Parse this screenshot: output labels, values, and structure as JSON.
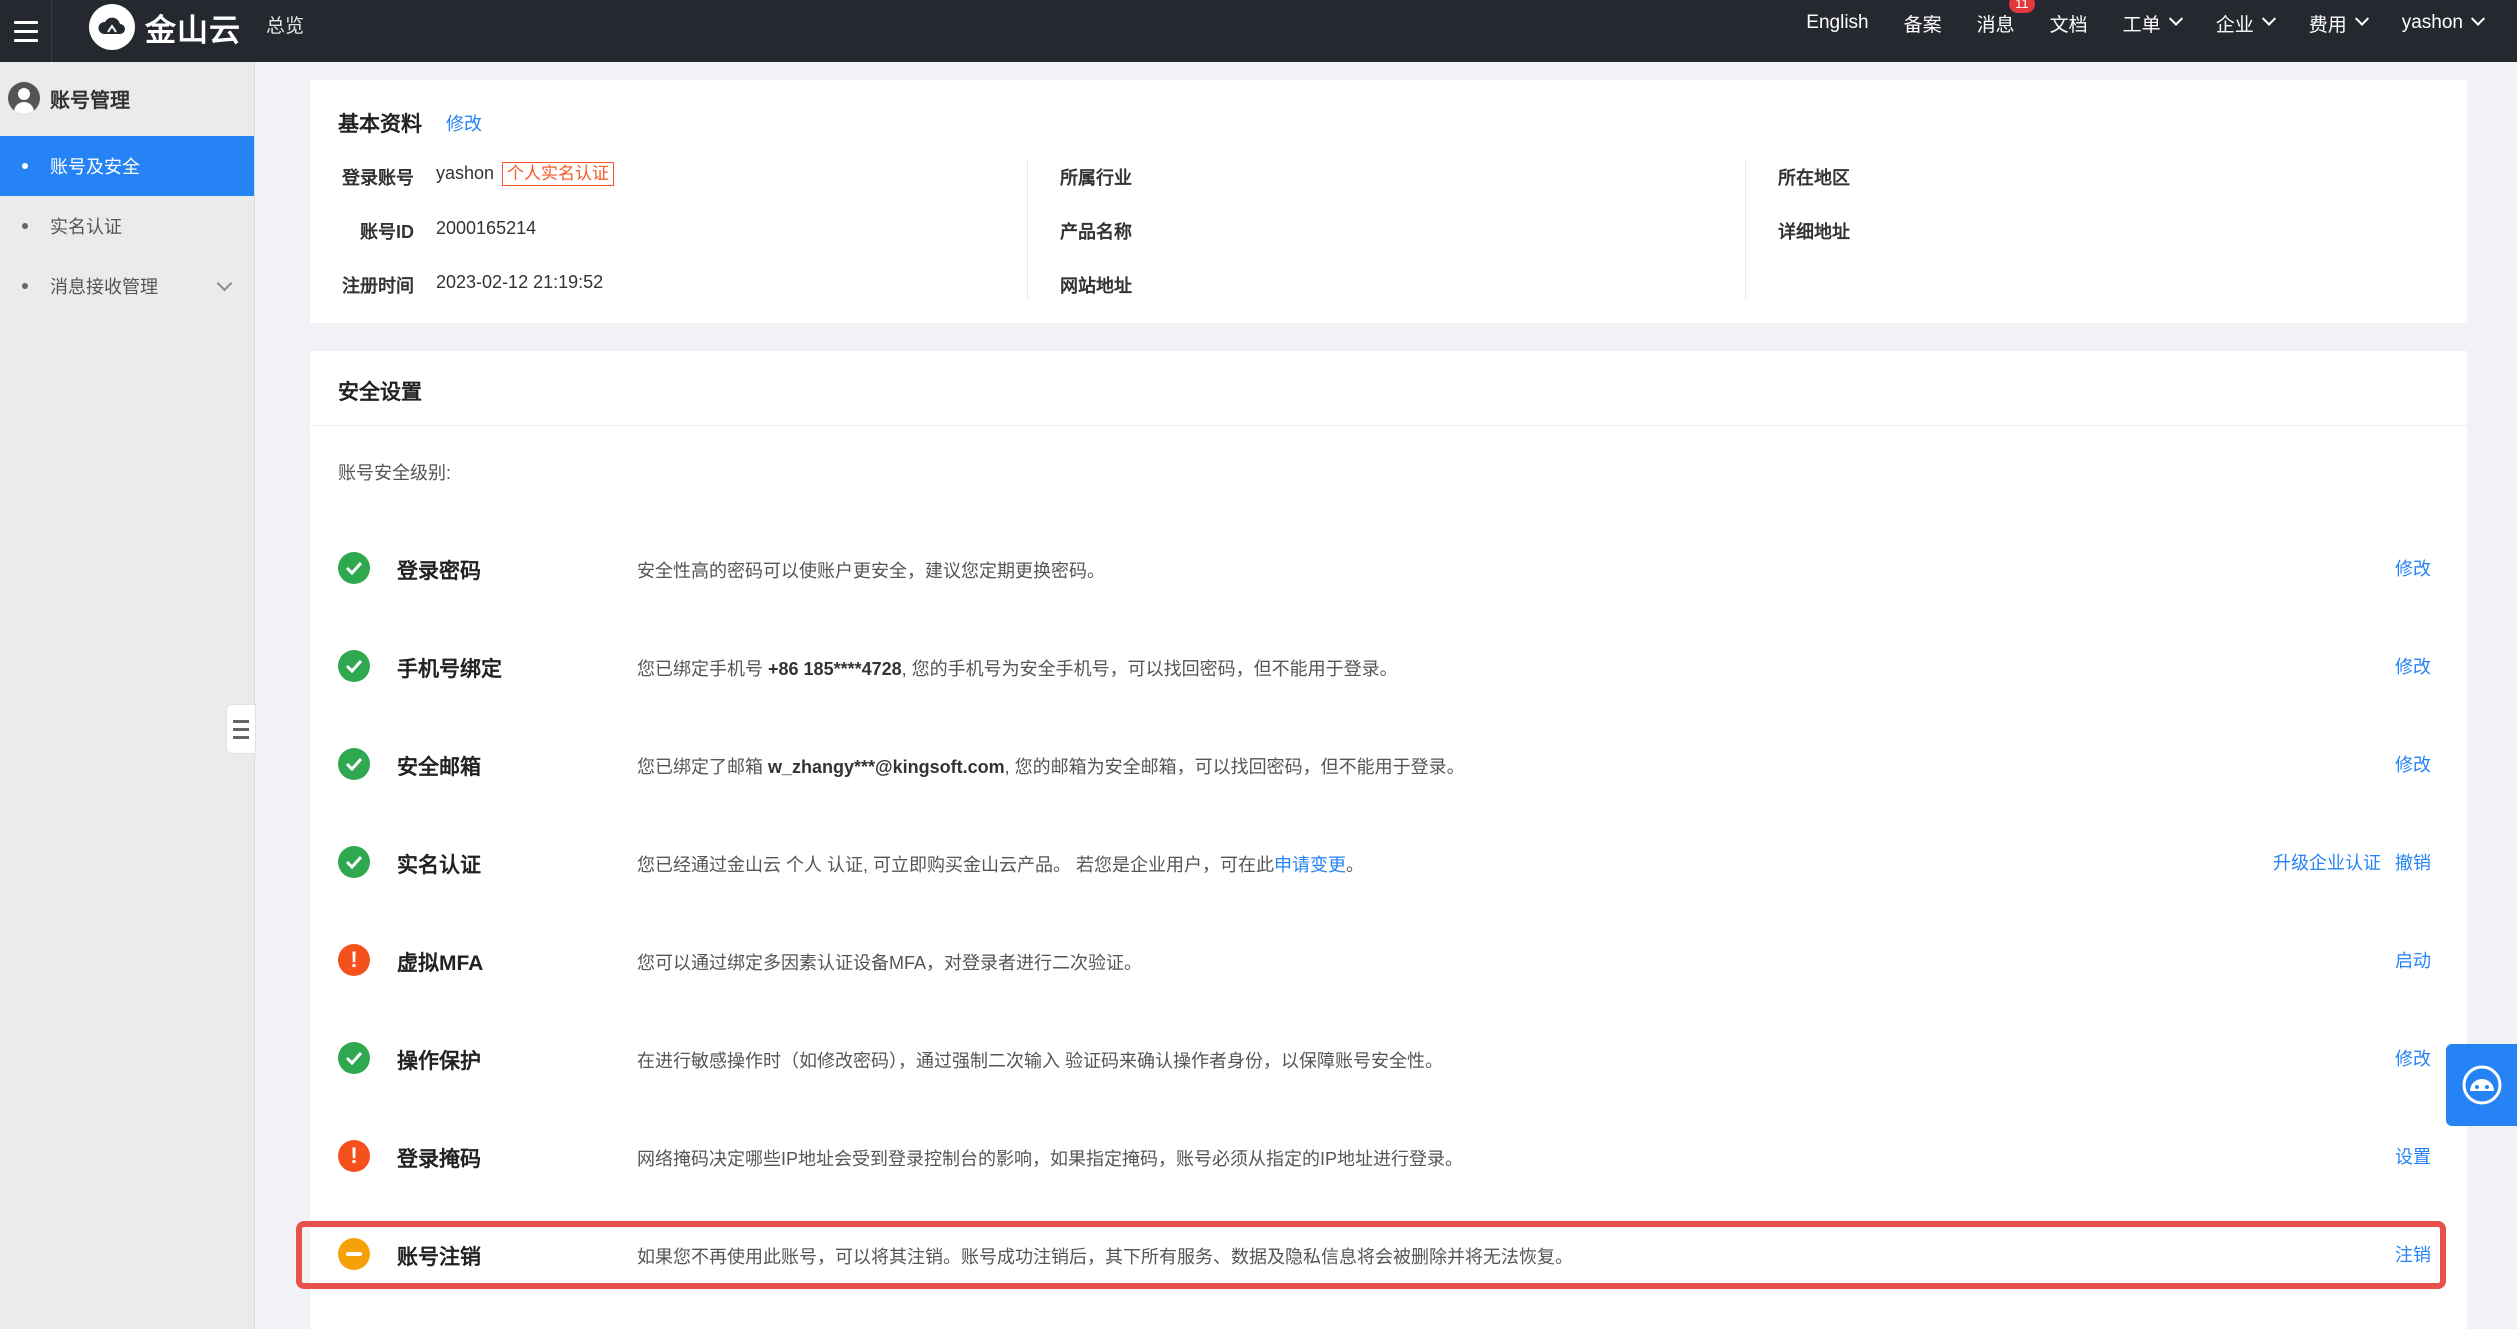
{
  "header": {
    "logo_text": "金山云",
    "overview": "总览",
    "nav": [
      {
        "label": "English"
      },
      {
        "label": "备案"
      },
      {
        "label": "消息",
        "badge": "11"
      },
      {
        "label": "文档"
      },
      {
        "label": "工单",
        "dropdown": true
      },
      {
        "label": "企业",
        "dropdown": true
      },
      {
        "label": "费用",
        "dropdown": true
      },
      {
        "label": "yashon",
        "dropdown": true
      }
    ]
  },
  "sidebar": {
    "title": "账号管理",
    "items": [
      {
        "label": "账号及安全",
        "active": true
      },
      {
        "label": "实名认证"
      },
      {
        "label": "消息接收管理",
        "expandable": true
      }
    ]
  },
  "basic": {
    "title": "基本资料",
    "edit": "修改",
    "login_account_label": "登录账号",
    "login_account_value": "yashon",
    "auth_tag": "个人实名认证",
    "account_id_label": "账号ID",
    "account_id_value": "2000165214",
    "reg_time_label": "注册时间",
    "reg_time_value": "2023-02-12 21:19:52",
    "industry_label": "所属行业",
    "product_label": "产品名称",
    "website_label": "网站地址",
    "region_label": "所在地区",
    "address_label": "详细地址"
  },
  "security": {
    "title": "安全设置",
    "level_label": "账号安全级别:",
    "items": [
      {
        "status": "ok",
        "name": "登录密码",
        "desc": "安全性高的密码可以使账户更安全，建议您定期更换密码。",
        "actions": [
          "修改"
        ]
      },
      {
        "status": "ok",
        "name": "手机号绑定",
        "desc_pre": "您已绑定手机号 ",
        "desc_bold": "+86 185****4728",
        "desc_post": ", 您的手机号为安全手机号，可以找回密码，但不能用于登录。",
        "actions": [
          "修改"
        ]
      },
      {
        "status": "ok",
        "name": "安全邮箱",
        "desc_pre": "您已绑定了邮箱 ",
        "desc_bold": "w_zhangy***@kingsoft.com",
        "desc_post": ", 您的邮箱为安全邮箱，可以找回密码，但不能用于登录。",
        "actions": [
          "修改"
        ]
      },
      {
        "status": "ok",
        "name": "实名认证",
        "desc_pre": "您已经通过金山云 个人 认证, 可立即购买金山云产品。 若您是企业用户，可在此",
        "desc_link": "申请变更",
        "desc_post": "。",
        "actions": [
          "升级企业认证",
          "撤销"
        ]
      },
      {
        "status": "warn",
        "name": "虚拟MFA",
        "desc": "您可以通过绑定多因素认证设备MFA，对登录者进行二次验证。",
        "actions": [
          "启动"
        ]
      },
      {
        "status": "ok",
        "name": "操作保护",
        "desc": "在进行敏感操作时（如修改密码），通过强制二次输入 验证码来确认操作者身份，以保障账号安全性。",
        "actions": [
          "修改"
        ]
      },
      {
        "status": "warn",
        "name": "登录掩码",
        "desc": "网络掩码决定哪些IP地址会受到登录控制台的影响，如果指定掩码，账号必须从指定的IP地址进行登录。",
        "actions": [
          "设置"
        ]
      },
      {
        "status": "pending",
        "name": "账号注销",
        "desc": "如果您不再使用此账号，可以将其注销。账号成功注销后，其下所有服务、数据及隐私信息将会被删除并将无法恢复。",
        "actions": [
          "注销"
        ]
      }
    ]
  },
  "colors": {
    "topbar": "#25282e",
    "accent": "#2683f5",
    "ok": "#2fa84f",
    "warn": "#f4511e",
    "pending": "#f6a10a",
    "highlight": "#e8504b"
  }
}
